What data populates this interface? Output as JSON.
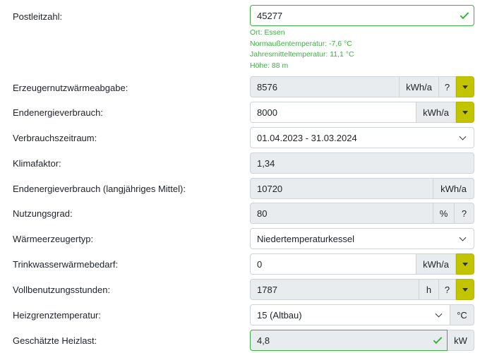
{
  "fields": {
    "postleitzahl": {
      "label": "Postleitzahl:",
      "value": "45277"
    },
    "location_info": [
      "Ort: Essen",
      "Normaußentemperatur: -7,6 °C",
      "Jahresmitteltemperatur: 11,1 °C",
      "Höhe: 88 m"
    ],
    "erzeugernutzwaermeabgabe": {
      "label": "Erzeugernutzwärmeabgabe:",
      "value": "8576",
      "unit": "kWh/a",
      "help": "?"
    },
    "endenergieverbrauch": {
      "label": "Endenergieverbrauch:",
      "value": "8000",
      "unit": "kWh/a"
    },
    "verbrauchszeitraum": {
      "label": "Verbrauchszeitraum:",
      "value": "01.04.2023 - 31.03.2024"
    },
    "klimafaktor": {
      "label": "Klimafaktor:",
      "value": "1,34"
    },
    "endenergieverbrauch_mittel": {
      "label": "Endenergieverbrauch (langjähriges Mittel):",
      "value": "10720",
      "unit": "kWh/a"
    },
    "nutzungsgrad": {
      "label": "Nutzungsgrad:",
      "value": "80",
      "unit": "%",
      "help": "?"
    },
    "waermeerzeugertyp": {
      "label": "Wärmeerzeugertyp:",
      "value": "Niedertemperaturkessel"
    },
    "trinkwasserwaermebedarf": {
      "label": "Trinkwasserwärmebedarf:",
      "value": "0",
      "unit": "kWh/a"
    },
    "vollbenutzungsstunden": {
      "label": "Vollbenutzungsstunden:",
      "value": "1787",
      "unit": "h",
      "help": "?"
    },
    "heizgrenztemperatur": {
      "label": "Heizgrenztemperatur:",
      "value": "15 (Altbau)",
      "unit": "°C"
    },
    "geschaetzte_heizlast": {
      "label": "Geschätzte Heizlast:",
      "value": "4,8",
      "unit": "kW"
    }
  },
  "colors": {
    "valid": "#3cb043",
    "accent_button": "#c3c400",
    "readonly_bg": "#e9ecef",
    "border": "#ced4da"
  }
}
